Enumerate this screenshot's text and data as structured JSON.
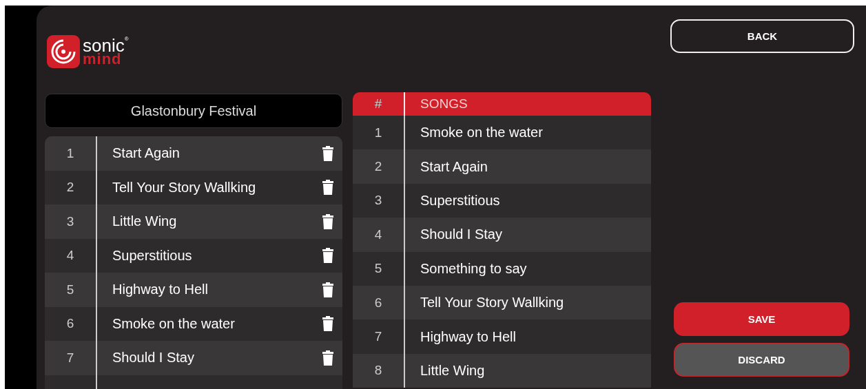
{
  "logo": {
    "word_top": "sonic",
    "registered": "®",
    "word_bottom": "mind"
  },
  "playlist": {
    "title": "Glastonbury Festival",
    "rows": [
      {
        "number": "1",
        "song": "Start Again"
      },
      {
        "number": "2",
        "song": "Tell Your Story Wallking"
      },
      {
        "number": "3",
        "song": "Little Wing"
      },
      {
        "number": "4",
        "song": "Superstitious"
      },
      {
        "number": "5",
        "song": "Highway to Hell"
      },
      {
        "number": "6",
        "song": "Smoke on the water"
      },
      {
        "number": "7",
        "song": "Should I Stay"
      }
    ]
  },
  "songs_table": {
    "columns": [
      "#",
      "SONGS"
    ],
    "rows": [
      {
        "number": "1",
        "song": "Smoke on the water"
      },
      {
        "number": "2",
        "song": "Start Again"
      },
      {
        "number": "3",
        "song": "Superstitious"
      },
      {
        "number": "4",
        "song": "Should I Stay"
      },
      {
        "number": "5",
        "song": "Something to say"
      },
      {
        "number": "6",
        "song": "Tell Your Story Wallking"
      },
      {
        "number": "7",
        "song": "Highway to Hell"
      },
      {
        "number": "8",
        "song": "Little Wing"
      }
    ]
  },
  "buttons": {
    "back": "BACK",
    "save": "SAVE",
    "discard": "DISCARD"
  }
}
